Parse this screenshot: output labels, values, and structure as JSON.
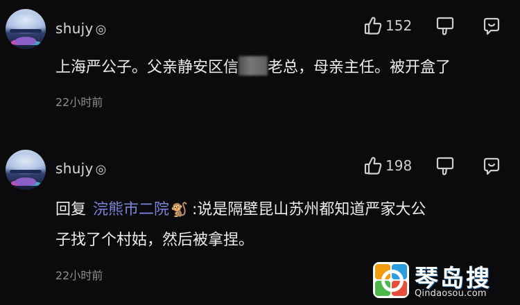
{
  "comments": [
    {
      "username": "shujy",
      "verified_mark": "◎",
      "likes": "152",
      "text_before_blur": "上海严公子。父亲静安区信",
      "text_after_blur": "老总，母亲主任。被开盒了",
      "time": "22小时前"
    },
    {
      "username": "shujy",
      "verified_mark": "◎",
      "likes": "198",
      "reply_prefix": "回复",
      "mention": "浣熊市二院",
      "mention_emoji": "🐒",
      "line1": ":说是隔壁昆山苏州都知道严家大公",
      "line2": "子找了个村姑，然后被拿捏。",
      "time": "22小时前"
    }
  ],
  "watermark": {
    "name": "琴岛搜",
    "url": "Qindaosou.com"
  },
  "icons": {
    "like": "thumbs-up-icon",
    "dislike": "thumbs-down-icon",
    "reply": "reply-bubble-icon"
  },
  "colors": {
    "background": "#0b0b0d",
    "text": "#ededed",
    "muted": "#8e8e8e",
    "mention": "#7b84d8"
  }
}
